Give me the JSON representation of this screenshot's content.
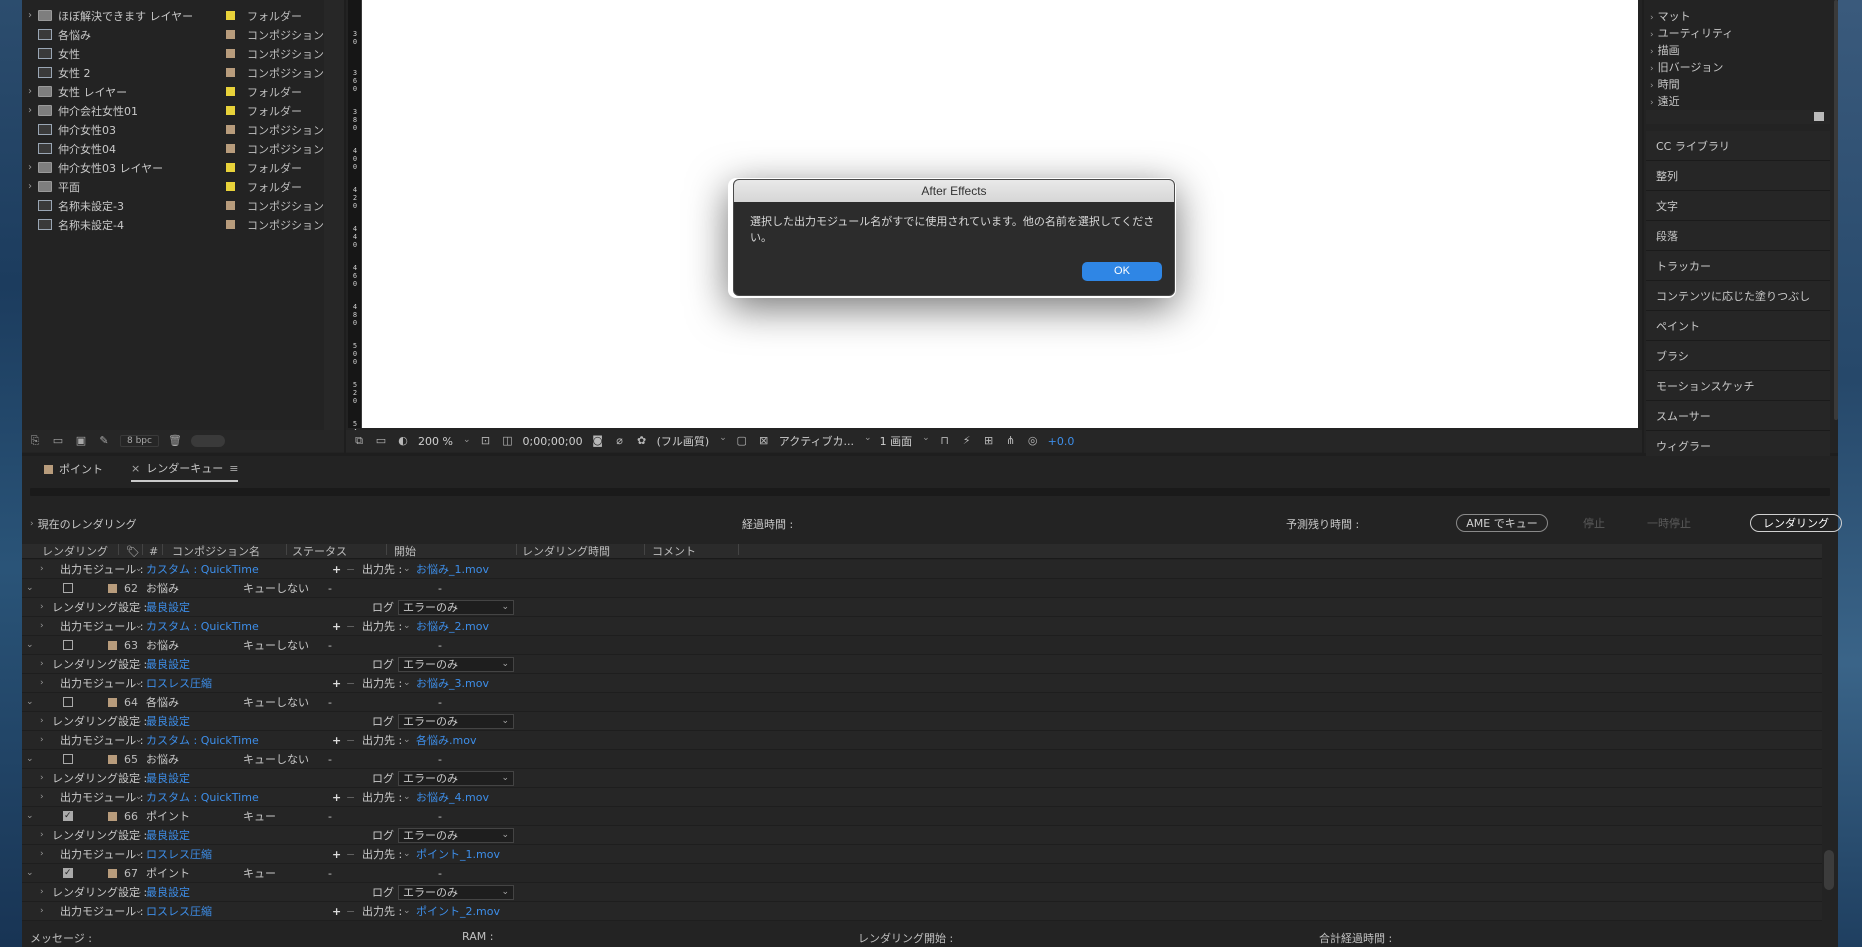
{
  "project": {
    "items": [
      {
        "name": "ほぼ解決できます レイヤー",
        "type": "フォルダー",
        "kind": "folder",
        "twisty": "›",
        "color": "#e8d23a"
      },
      {
        "name": "各悩み",
        "type": "コンポジション",
        "kind": "comp",
        "twisty": "",
        "color": "#b89c7c"
      },
      {
        "name": "女性",
        "type": "コンポジション",
        "kind": "comp",
        "twisty": "",
        "color": "#b89c7c"
      },
      {
        "name": "女性 2",
        "type": "コンポジション",
        "kind": "comp",
        "twisty": "",
        "color": "#b89c7c"
      },
      {
        "name": "女性 レイヤー",
        "type": "フォルダー",
        "kind": "folder",
        "twisty": "›",
        "color": "#e8d23a"
      },
      {
        "name": "仲介会社女性01",
        "type": "フォルダー",
        "kind": "folder",
        "twisty": "›",
        "color": "#e8d23a"
      },
      {
        "name": "仲介女性03",
        "type": "コンポジション",
        "kind": "comp",
        "twisty": "",
        "color": "#b89c7c"
      },
      {
        "name": "仲介女性04",
        "type": "コンポジション",
        "kind": "comp",
        "twisty": "",
        "color": "#b89c7c"
      },
      {
        "name": "仲介女性03 レイヤー",
        "type": "フォルダー",
        "kind": "folder",
        "twisty": "›",
        "color": "#e8d23a"
      },
      {
        "name": "平面",
        "type": "フォルダー",
        "kind": "folder",
        "twisty": "›",
        "color": "#e8d23a"
      },
      {
        "name": "名称未設定-3",
        "type": "コンポジション",
        "kind": "comp",
        "twisty": "",
        "color": "#b89c7c"
      },
      {
        "name": "名称未設定-4",
        "type": "コンポジション",
        "kind": "comp",
        "twisty": "",
        "color": "#b89c7c"
      }
    ],
    "footer": {
      "bpc": "8 bpc"
    }
  },
  "viewer": {
    "ruler_ticks": [
      "3\n0",
      "3\n6\n0",
      "3\n8\n0",
      "4\n0\n0",
      "4\n2\n0",
      "4\n4\n0",
      "4\n6\n0",
      "4\n8\n0",
      "5\n0\n0",
      "5\n2\n0",
      "5\n4\n0"
    ],
    "zoom": "200 %",
    "timecode": "0;00;00;00",
    "resolution": "(フル画質)",
    "camera": "アクティブカ...",
    "views": "1 画面",
    "exposure": "+0.0"
  },
  "effects": {
    "categories": [
      "マット",
      "ユーティリティ",
      "描画",
      "旧バージョン",
      "時間",
      "遠近"
    ]
  },
  "panels": [
    "CC ライブラリ",
    "整列",
    "文字",
    "段落",
    "トラッカー",
    "コンテンツに応じた塗りつぶし",
    "ペイント",
    "ブラシ",
    "モーションスケッチ",
    "スムーサー",
    "ウィグラー"
  ],
  "render_queue": {
    "tabs": {
      "points": "ポイント",
      "queue": "レンダーキュー"
    },
    "current_render": "現在のレンダリング",
    "elapsed": "経過時間 :",
    "remaining": "予測残り時間 :",
    "ame_button": "AME でキュー",
    "stop_button": "停止",
    "pause_button": "一時停止",
    "render_button": "レンダリング",
    "headers": {
      "render": "レンダリング",
      "num": "#",
      "comp": "コンポジション名",
      "status": "ステータス",
      "start": "開始",
      "render_time": "レンダリング時間",
      "comment": "コメント"
    },
    "labels": {
      "output_module": "出力モジュール :",
      "render_settings": "レンダリング設定 :",
      "log": "ログ :",
      "output_to": "出力先 :",
      "dash": "-",
      "best": "最良設定",
      "error_only": "エラーのみ"
    },
    "rows": [
      {
        "kind": "om",
        "module": "カスタム : QuickTime",
        "file": "お悩み_1.mov"
      },
      {
        "kind": "item",
        "num": "62",
        "comp": "お悩み",
        "status": "キューしない",
        "checked": false
      },
      {
        "kind": "rs"
      },
      {
        "kind": "om",
        "module": "カスタム : QuickTime",
        "file": "お悩み_2.mov"
      },
      {
        "kind": "item",
        "num": "63",
        "comp": "お悩み",
        "status": "キューしない",
        "checked": false
      },
      {
        "kind": "rs"
      },
      {
        "kind": "om",
        "module": "ロスレス圧縮",
        "file": "お悩み_3.mov"
      },
      {
        "kind": "item",
        "num": "64",
        "comp": "各悩み",
        "status": "キューしない",
        "checked": false
      },
      {
        "kind": "rs"
      },
      {
        "kind": "om",
        "module": "カスタム : QuickTime",
        "file": "各悩み.mov"
      },
      {
        "kind": "item",
        "num": "65",
        "comp": "お悩み",
        "status": "キューしない",
        "checked": false
      },
      {
        "kind": "rs"
      },
      {
        "kind": "om",
        "module": "カスタム : QuickTime",
        "file": "お悩み_4.mov"
      },
      {
        "kind": "item",
        "num": "66",
        "comp": "ポイント",
        "status": "キュー",
        "checked": true
      },
      {
        "kind": "rs"
      },
      {
        "kind": "om",
        "module": "ロスレス圧縮",
        "file": "ポイント_1.mov"
      },
      {
        "kind": "item",
        "num": "67",
        "comp": "ポイント",
        "status": "キュー",
        "checked": true
      },
      {
        "kind": "rs"
      },
      {
        "kind": "om",
        "module": "ロスレス圧縮",
        "file": "ポイント_2.mov"
      }
    ],
    "footer": {
      "message": "メッセージ :",
      "ram": "RAM :",
      "render_start": "レンダリング開始 :",
      "total_elapsed": "合計経過時間 :"
    }
  },
  "dialog": {
    "title": "After Effects",
    "message": "選択した出力モジュール名がすでに使用されています。他の名前を選択してください。",
    "ok": "OK"
  }
}
